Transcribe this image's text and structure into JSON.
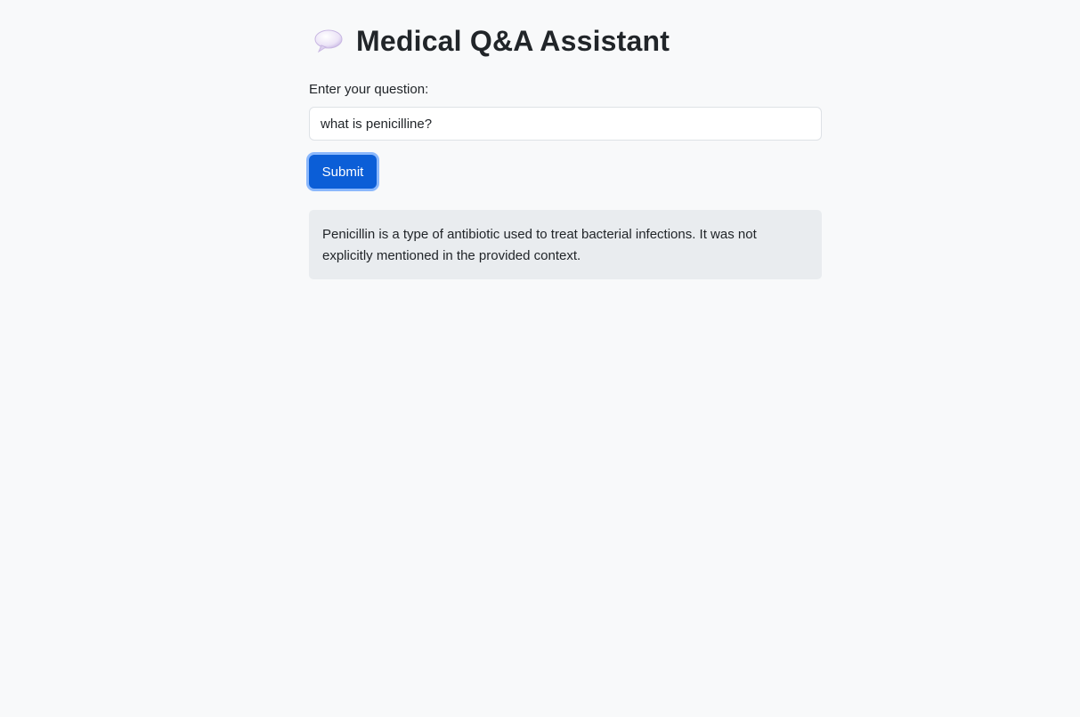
{
  "header": {
    "title": "Medical Q&A Assistant",
    "icon": "speech-bubble-icon"
  },
  "form": {
    "label": "Enter your question:",
    "input_value": "what is penicilline?",
    "submit_label": "Submit"
  },
  "answer": {
    "text": "Penicillin is a type of antibiotic used to treat bacterial infections. It was not explicitly mentioned in the provided context."
  },
  "colors": {
    "background": "#f8f9fa",
    "button": "#0b5ed7",
    "answer_background": "#e9ecef"
  }
}
